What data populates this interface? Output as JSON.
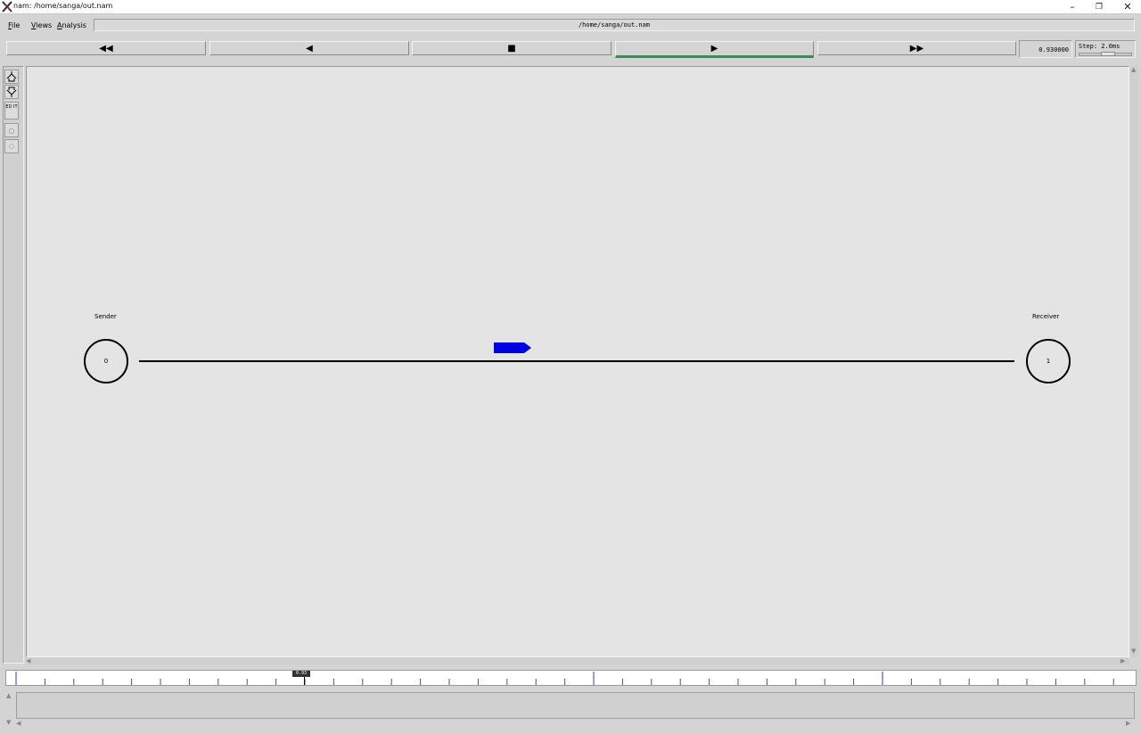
{
  "window": {
    "title": "nam: /home/sanga/out.nam",
    "minimize_glyph": "–",
    "maximize_glyph": "❐",
    "close_glyph": "✕"
  },
  "menu": {
    "file_mnemonic": "F",
    "file_rest": "ile",
    "views_mnemonic": "V",
    "views_rest": "iews",
    "analysis_mnemonic": "A",
    "analysis_rest": "nalysis"
  },
  "path_field": "/home/sanga/out.nam",
  "transport": {
    "rewind": "◀◀",
    "back": "◀",
    "stop": "■",
    "play": "▶",
    "fast_forward": "▶▶",
    "active": "play"
  },
  "time_display": "0.930000",
  "step": {
    "label": "Step: 2.0ms"
  },
  "toolbar": {
    "edit_label": "ED IT"
  },
  "network": {
    "nodes": [
      {
        "id": "0",
        "label": "Sender"
      },
      {
        "id": "1",
        "label": "Receiver"
      }
    ],
    "packet_color": "#0000e0",
    "link_color": "#000000"
  },
  "timeline": {
    "marker_text": "0.93"
  },
  "colors": {
    "canvas_bg": "#e4e4e4",
    "play_indicator": "#3a8a5a",
    "timeline_blue": "#3333cc"
  }
}
